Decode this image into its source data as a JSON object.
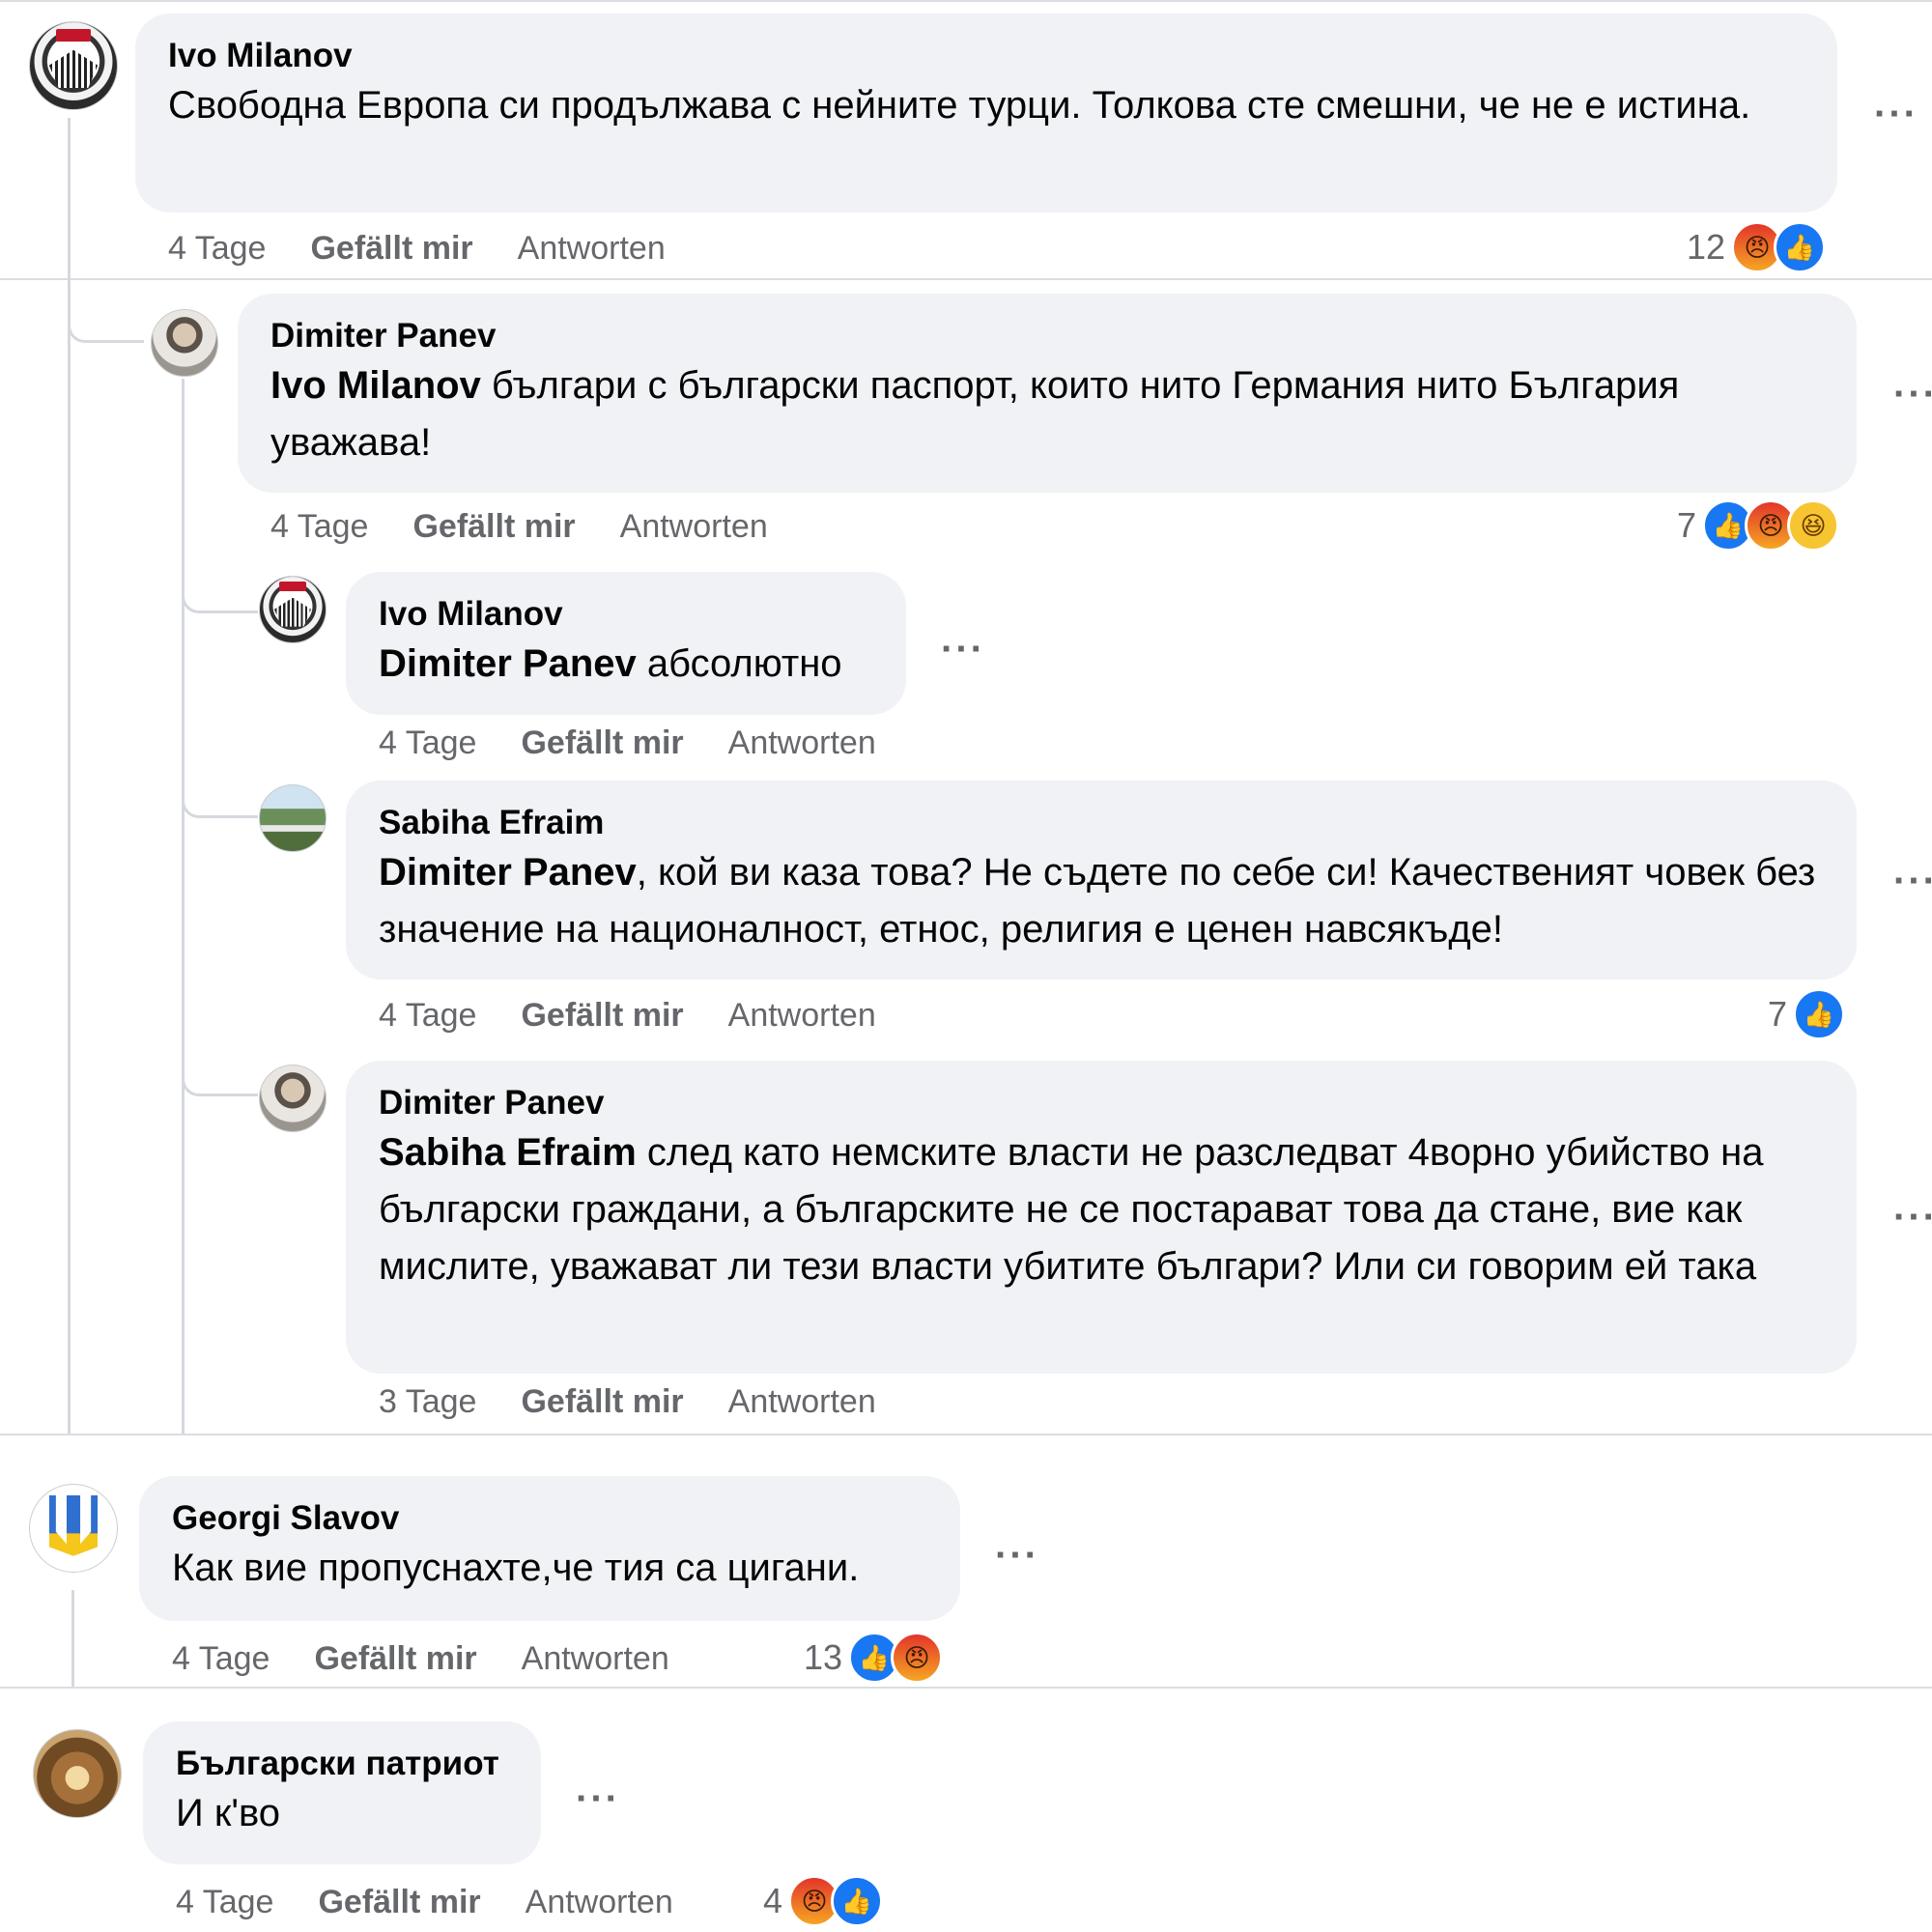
{
  "comments": [
    {
      "author": "Ivo Milanov",
      "text": "Свободна Европа си продължава с нейните турци. Толкова сте смешни, че не е истина.",
      "time": "4 Tage",
      "like": "Gefällt mir",
      "reply": "Antworten",
      "reaction_count": "12",
      "reactions": [
        "angry",
        "like"
      ]
    },
    {
      "author": "Dimiter Panev",
      "mention": "Ivo Milanov",
      "text": " българи с български паспорт, които нито Германия нито България уважава!",
      "time": "4 Tage",
      "like": "Gefällt mir",
      "reply": "Antworten",
      "reaction_count": "7",
      "reactions": [
        "like",
        "angry",
        "haha"
      ]
    },
    {
      "author": "Ivo Milanov",
      "mention": "Dimiter Panev",
      "text": " абсолютно",
      "time": "4 Tage",
      "like": "Gefällt mir",
      "reply": "Antworten"
    },
    {
      "author": "Sabiha Efraim",
      "mention": "Dimiter Panev",
      "text": ", кой ви каза това? Не съдете по себе си! Качественият човек без значение на националност, етнос, религия е ценен навсякъде!",
      "time": "4 Tage",
      "like": "Gefällt mir",
      "reply": "Antworten",
      "reaction_count": "7",
      "reactions": [
        "like"
      ]
    },
    {
      "author": "Dimiter Panev",
      "mention": "Sabiha Efraim",
      "text": " след като немските власти не разследват 4ворно убийство на български граждани, а българските не се постарават това да стане, вие как мислите, уважават ли тези власти убитите българи? Или си говорим ей така",
      "time": "3 Tage",
      "like": "Gefällt mir",
      "reply": "Antworten"
    },
    {
      "author": "Georgi Slavov",
      "text": "Как вие пропуснахте,че тия са цигани.",
      "time": "4 Tage",
      "like": "Gefällt mir",
      "reply": "Antworten",
      "reaction_count": "13",
      "reactions": [
        "like",
        "angry"
      ]
    },
    {
      "author": "Български патриот",
      "text": "И к'во",
      "time": "4 Tage",
      "like": "Gefällt mir",
      "reply": "Antworten",
      "reaction_count": "4",
      "reactions": [
        "angry",
        "like"
      ]
    }
  ],
  "icons": {
    "like": "thumbs-up-icon",
    "angry": "angry-face-icon",
    "haha": "laughing-face-icon",
    "more": "more-options-icon"
  },
  "colors": {
    "bubble": "#f0f2f5",
    "meta_text": "#65676b",
    "like_blue": "#1877f2",
    "thread_line": "#d5d8dd"
  }
}
